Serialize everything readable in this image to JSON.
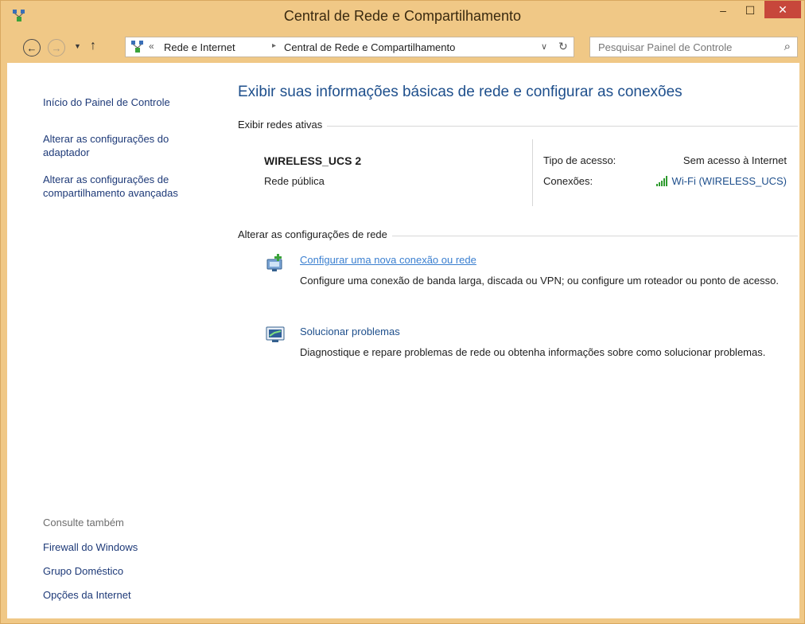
{
  "window": {
    "title": "Central de Rede e Compartilhamento",
    "controls": {
      "minimize": "–",
      "maximize": "☐",
      "close": "✕"
    }
  },
  "navigation": {
    "back_glyph": "←",
    "forward_glyph": "→",
    "recent_glyph": "▼",
    "up_glyph": "↑",
    "overflow_glyph": "«",
    "breadcrumbs": [
      "Rede e Internet",
      "Central de Rede e Compartilhamento"
    ],
    "separator_glyph": "▸",
    "dropdown_glyph": "∨",
    "refresh_glyph": "↻",
    "search_placeholder": "Pesquisar Painel de Controle",
    "search_glyph": "⌕"
  },
  "sidebar": {
    "home_link": "Início do Painel de Controle",
    "links": [
      "Alterar as configurações do adaptador",
      "Alterar as configurações de compartilhamento avançadas"
    ],
    "see_also_label": "Consulte também",
    "see_also": [
      "Firewall do Windows",
      "Grupo Doméstico",
      "Opções da Internet"
    ]
  },
  "main": {
    "title": "Exibir suas informações básicas de rede e configurar as conexões",
    "active_networks_label": "Exibir redes ativas",
    "network": {
      "name": "WIRELESS_UCS  2",
      "type": "Rede pública",
      "access_type_label": "Tipo de acesso:",
      "access_type_value": "Sem acesso à Internet",
      "connections_label": "Conexões:",
      "connections_value": "Wi-Fi (WIRELESS_UCS)"
    },
    "change_settings_label": "Alterar as configurações de rede",
    "tasks": [
      {
        "icon": "new-connection-icon",
        "title": "Configurar uma nova conexão ou rede",
        "description": "Configure uma conexão de banda larga, discada ou VPN; ou configure um roteador ou ponto de acesso."
      },
      {
        "icon": "troubleshoot-icon",
        "title": "Solucionar problemas",
        "description": "Diagnostique e repare problemas de rede ou obtenha informações sobre como solucionar problemas."
      }
    ]
  },
  "colors": {
    "titlebar": "#f0c886",
    "close_button": "#c7473b",
    "link": "#1e4f8c",
    "hover_link": "#3a7fd0",
    "signal": "#2e9a2e"
  }
}
